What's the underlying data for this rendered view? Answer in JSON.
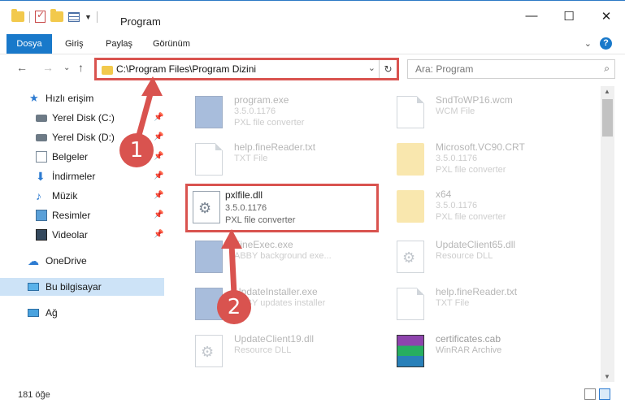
{
  "window": {
    "title": "Program",
    "buttons": {
      "minimize": "—",
      "maximize": "☐",
      "close": "✕"
    }
  },
  "ribbon": {
    "tabs": [
      "Dosya",
      "Giriş",
      "Paylaş",
      "Görünüm"
    ],
    "expand": "⌄",
    "help": "?"
  },
  "nav": {
    "back": "←",
    "forward": "→",
    "recent": "⌄",
    "up": "↑",
    "address": "C:\\Program Files\\Program Dizini",
    "address_dropdown": "⌄",
    "refresh": "↻",
    "search_placeholder": "Ara: Program",
    "search_icon": "⌕"
  },
  "sidebar": {
    "quick_access": "Hızlı erişim",
    "items": [
      {
        "label": "Yerel Disk (C:)",
        "icon": "disk-icon"
      },
      {
        "label": "Yerel Disk (D:)",
        "icon": "disk-icon"
      },
      {
        "label": "Belgeler",
        "icon": "documents-icon"
      },
      {
        "label": "İndirmeler",
        "icon": "downloads-icon"
      },
      {
        "label": "Müzik",
        "icon": "music-icon"
      },
      {
        "label": "Resimler",
        "icon": "pictures-icon"
      },
      {
        "label": "Videolar",
        "icon": "videos-icon"
      }
    ],
    "onedrive": "OneDrive",
    "this_pc": "Bu bilgisayar",
    "network": "Ağ",
    "pin": "📌"
  },
  "files": [
    {
      "name": "program.exe",
      "l2": "3.5.0.1176",
      "l3": "PXL file converter",
      "icon": "exe"
    },
    {
      "name": "SndToWP16.wcm",
      "l2": "WCM File",
      "l3": "",
      "icon": "doc"
    },
    {
      "name": "help.fineReader.txt",
      "l2": "TXT File",
      "l3": "",
      "icon": "doc"
    },
    {
      "name": "Microsoft.VC90.CRT",
      "l2": "3.5.0.1176",
      "l3": "PXL file converter",
      "icon": "folder"
    },
    {
      "name": "pxlfile.dll",
      "l2": "3.5.0.1176",
      "l3": "PXL file converter",
      "icon": "gear"
    },
    {
      "name": "x64",
      "l2": "3.5.0.1176",
      "l3": "PXL file converter",
      "icon": "folder"
    },
    {
      "name": "FineExec.exe",
      "l2": "ABBY background exe...",
      "l3": "",
      "icon": "exe"
    },
    {
      "name": "UpdateClient65.dll",
      "l2": "Resource DLL",
      "l3": "",
      "icon": "gear"
    },
    {
      "name": "UpdateInstaller.exe",
      "l2": "ABBY updates installer",
      "l3": "",
      "icon": "exe"
    },
    {
      "name": "help.fineReader.txt",
      "l2": "TXT File",
      "l3": "",
      "icon": "doc"
    },
    {
      "name": "UpdateClient19.dll",
      "l2": "Resource DLL",
      "l3": "",
      "icon": "gear"
    },
    {
      "name": "certificates.cab",
      "l2": "WinRAR Archive",
      "l3": "",
      "icon": "rar"
    }
  ],
  "status": {
    "count": "181 öğe"
  },
  "annotations": {
    "step1": "1",
    "step2": "2"
  },
  "colors": {
    "accent": "#1979ca",
    "highlight": "#d9534f",
    "selected": "#cde3f7"
  }
}
